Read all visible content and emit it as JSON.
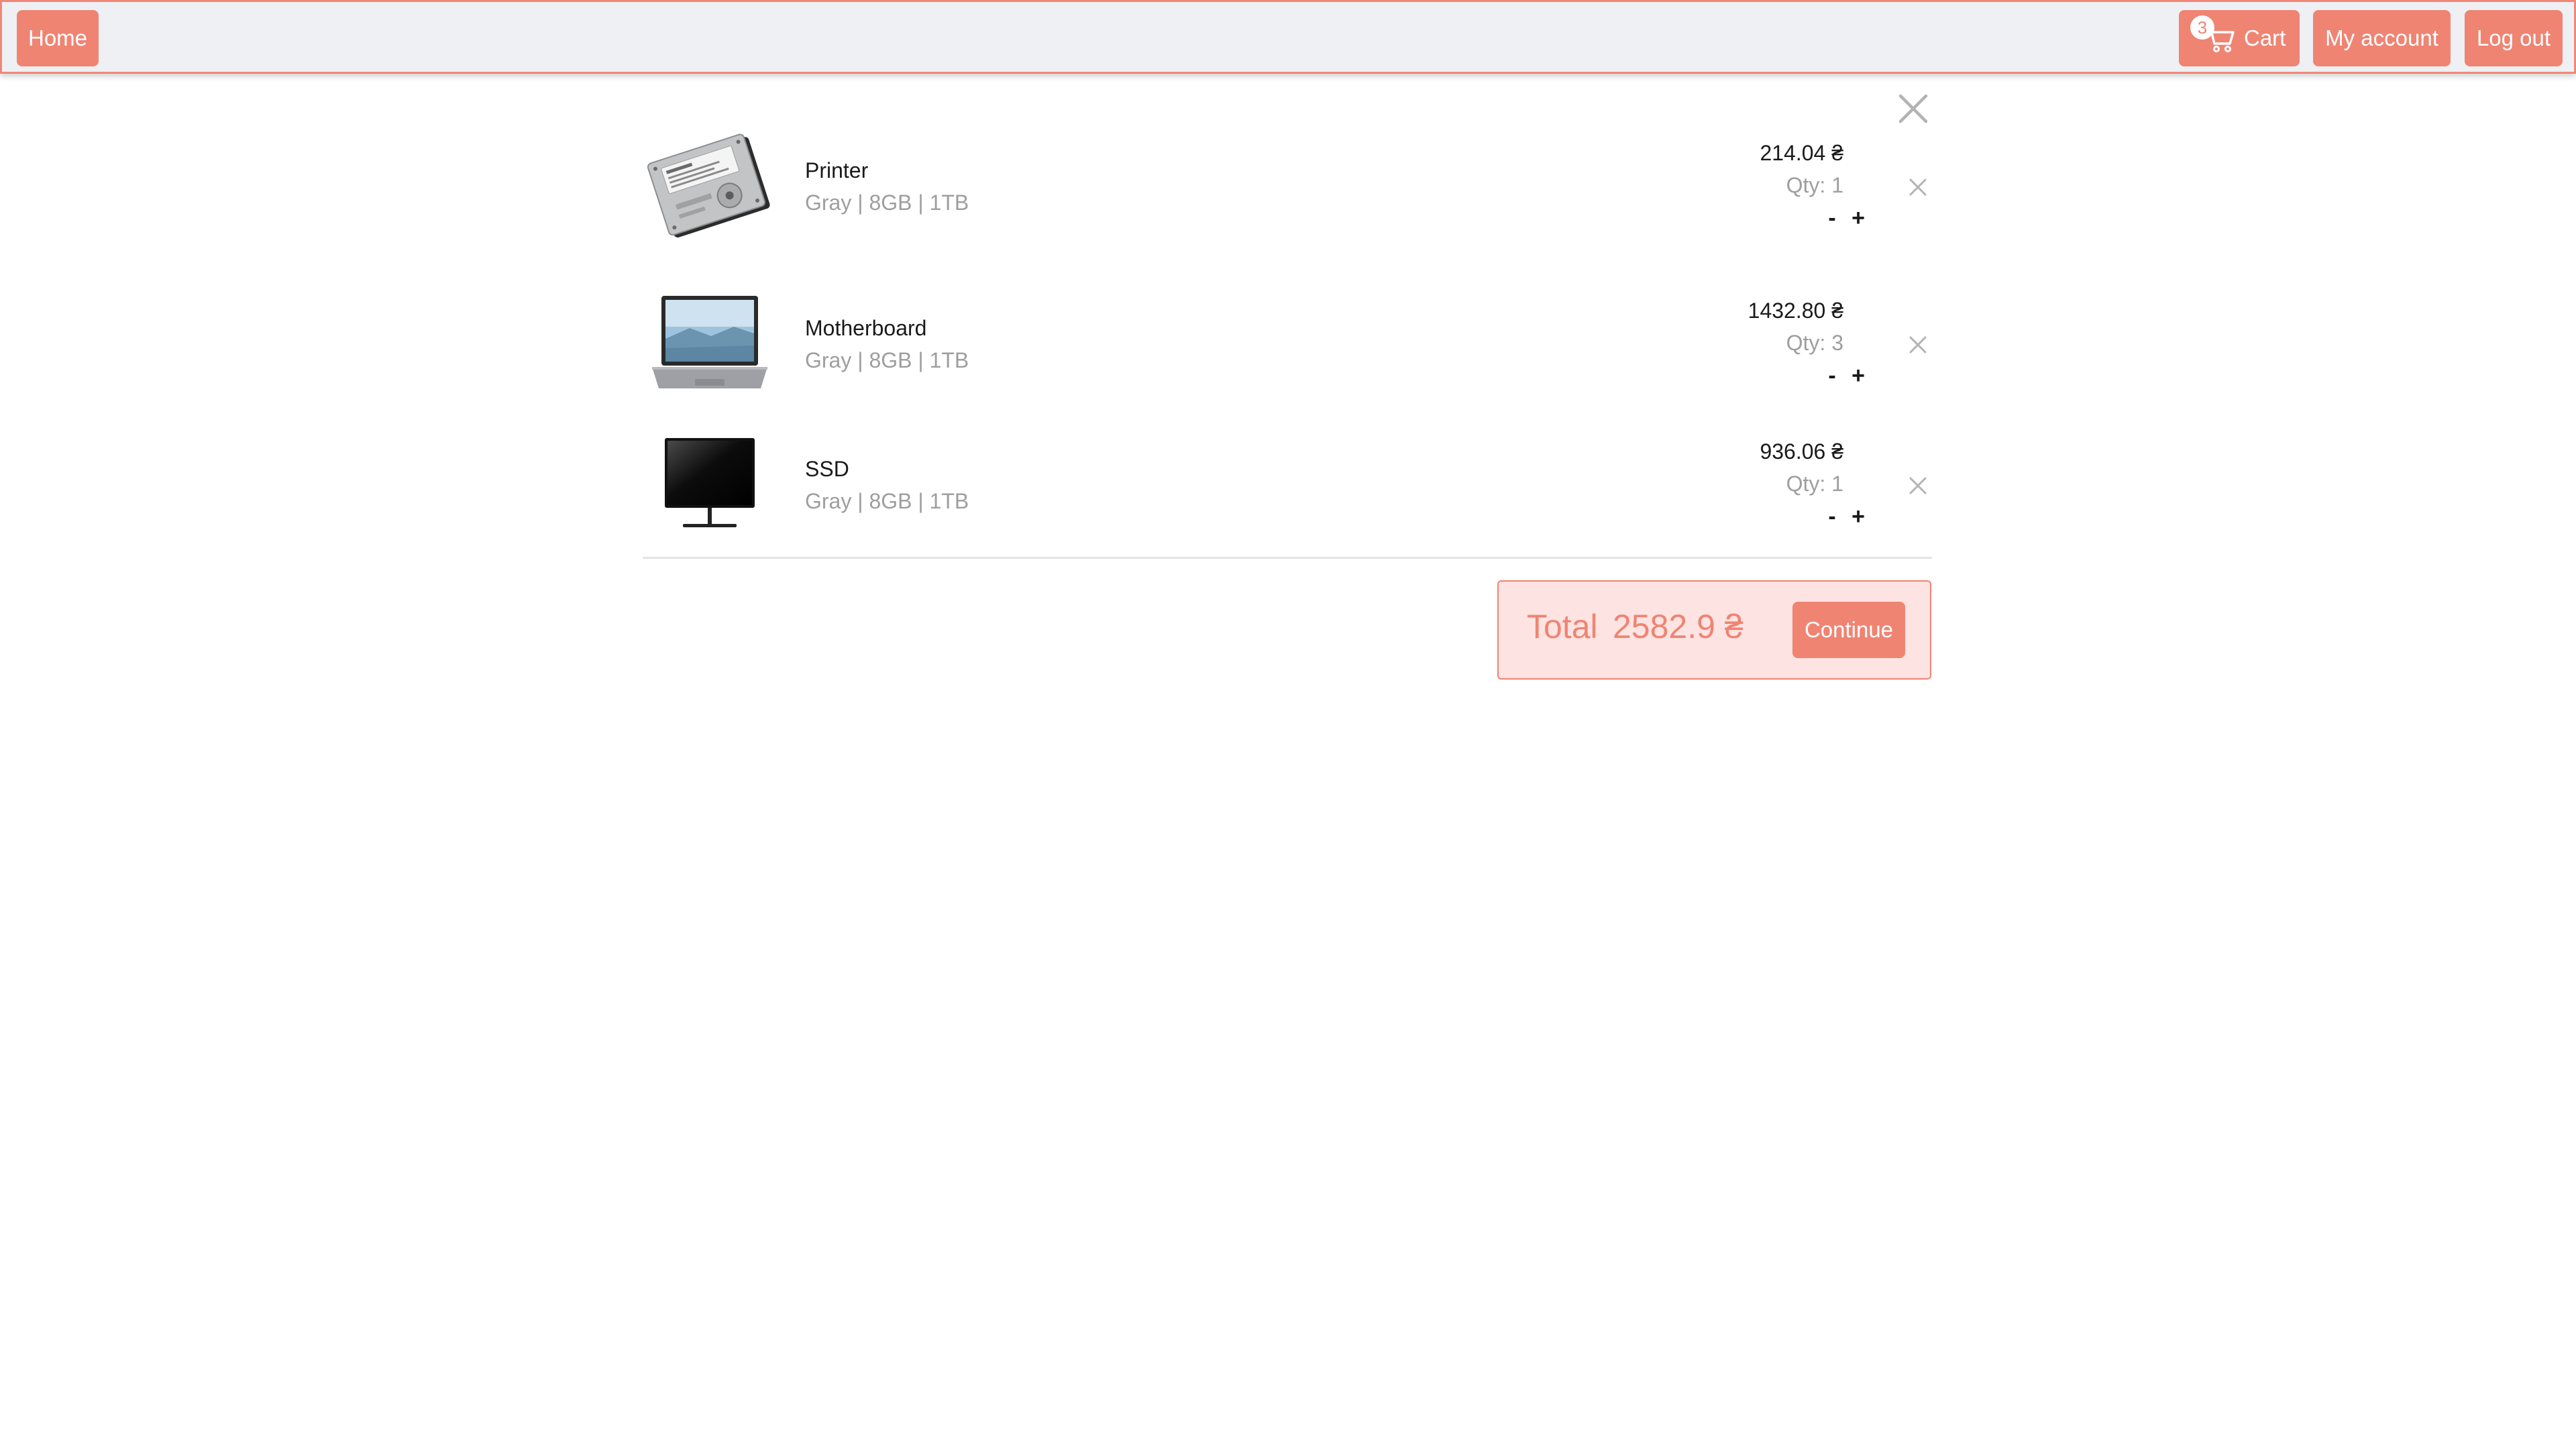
{
  "nav": {
    "home_label": "Home",
    "cart_label": "Cart",
    "cart_count": "3",
    "account_label": "My account",
    "logout_label": "Log out"
  },
  "cart": {
    "items": [
      {
        "name": "Printer",
        "variant": "Gray | 8GB | 1TB",
        "price": "214.04 ₴",
        "qty": "Qty: 1",
        "image": "hard-drive-image"
      },
      {
        "name": "Motherboard",
        "variant": "Gray | 8GB | 1TB",
        "price": "1432.80 ₴",
        "qty": "Qty: 3",
        "image": "laptop-image"
      },
      {
        "name": "SSD",
        "variant": "Gray | 8GB | 1TB",
        "price": "936.06 ₴",
        "qty": "Qty: 1",
        "image": "monitor-image"
      }
    ],
    "minus_label": "-",
    "plus_label": "+",
    "total_label": "Total",
    "total_value": "2582.9 ₴",
    "continue_label": "Continue"
  },
  "colors": {
    "accent": "#ef8473",
    "navbar_bg": "#eef0f4",
    "total_bg": "#fde3e1",
    "muted_text": "#9e9e9e"
  }
}
